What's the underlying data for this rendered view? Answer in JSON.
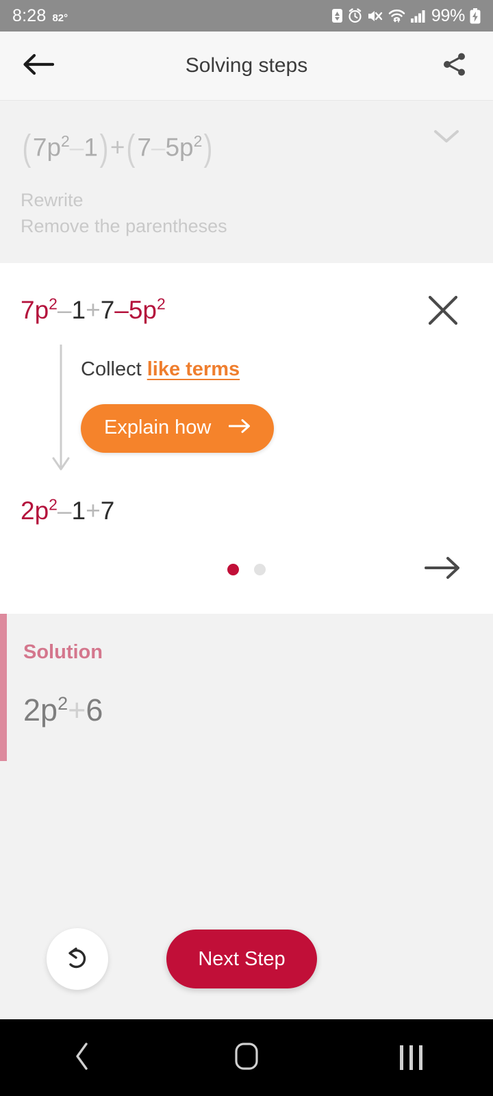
{
  "status_bar": {
    "time": "8:28",
    "temperature": "82°",
    "battery_percent": "99%",
    "icons": [
      "battery-saver-icon",
      "alarm-icon",
      "mute-icon",
      "wifi-icon",
      "cellular-signal-icon",
      "charging-battery-icon"
    ]
  },
  "app_bar": {
    "back_icon": "back-arrow-icon",
    "title": "Solving steps",
    "share_icon": "share-icon"
  },
  "previous_step": {
    "expression": {
      "open1": "(",
      "term1": "7p",
      "exp1": "2",
      "op1": "–",
      "term2": "1",
      "close1": ")",
      "op2": "+",
      "open2": "(",
      "term3": "7",
      "op3": "–",
      "term4": "5p",
      "exp2": "2",
      "close2": ")"
    },
    "label_line1": "Rewrite",
    "label_line2": "Remove the parentheses",
    "expand_icon": "chevron-down-icon"
  },
  "current_step": {
    "close_icon": "close-icon",
    "expression": {
      "t1": "7p",
      "e1": "2",
      "op1": "–",
      "t2": "1",
      "op2": "+",
      "t3": "7",
      "op3": "–",
      "t4": "5p",
      "e2": "2"
    },
    "hint_prefix": "Collect ",
    "hint_link": "like terms",
    "explain_label": "Explain how",
    "explain_arrow_icon": "arrow-right-icon",
    "flow_arrow_icon": "arrow-down-icon",
    "result": {
      "t1": "2p",
      "e1": "2",
      "op1": "–",
      "t2": "1",
      "op2": "+",
      "t3": "7"
    },
    "pagination": {
      "total": 2,
      "active_index": 0
    },
    "next_icon": "arrow-right-icon"
  },
  "solution": {
    "title": "Solution",
    "expression": {
      "base": "2p",
      "exponent": "2",
      "op": "+",
      "term": "6"
    },
    "accent_color": "#dd8a9d"
  },
  "bottom_actions": {
    "undo_icon": "undo-icon",
    "next_step_label": "Next Step"
  },
  "nav_bar": {
    "back_icon": "android-back-icon",
    "home_icon": "android-home-icon",
    "recents_icon": "android-recents-icon"
  },
  "colors": {
    "accent_red": "#c10f38",
    "math_red": "#b4123c",
    "accent_orange": "#f5832b",
    "link_orange": "#ef7e2e",
    "solution_pink": "#d4778d"
  }
}
